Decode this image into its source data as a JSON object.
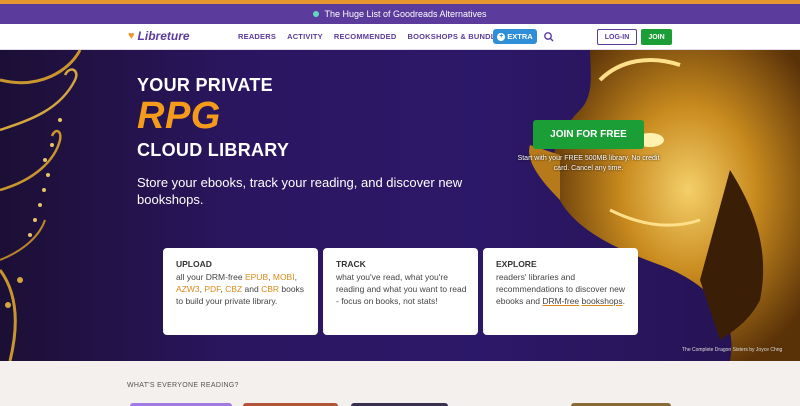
{
  "announcement": {
    "text": "The Huge List of Goodreads Alternatives"
  },
  "nav": {
    "logo": "Libreture",
    "links": [
      "READERS",
      "ACTIVITY",
      "RECOMMENDED",
      "BOOKSHOPS & BUNDLES"
    ],
    "extra": "EXTRA",
    "login": "LOG-IN",
    "join": "JOIN"
  },
  "hero": {
    "line1": "YOUR PRIVATE",
    "line2": "RPG",
    "line3": "CLOUD LIBRARY",
    "subtitle": "Store your ebooks, track your reading, and discover new bookshops.",
    "cta": "JOIN FOR FREE",
    "cta_note": "Start with your FREE 500MB library. No credit card. Cancel any time.",
    "credit": "The Complete Dragon Sisters by Joyce Chng"
  },
  "cards": [
    {
      "title": "UPLOAD",
      "pre": "all your DRM-free ",
      "links": [
        "EPUB",
        "MOBI",
        "AZW3",
        "PDF",
        "CBZ",
        "CBR"
      ],
      "post": " books to build your private library."
    },
    {
      "title": "TRACK",
      "body": "what you've read, what you're reading and what you want to read - focus on books, not stats!"
    },
    {
      "title": "EXPLORE",
      "pre": "readers' libraries and recommendations to discover new ebooks and ",
      "link1": "DRM-free",
      "link2": "bookshops",
      "post": "."
    }
  ],
  "section": {
    "label": "WHAT'S EVERYONE READING?"
  },
  "colors": {
    "brand_purple": "#5b3b9c",
    "accent_orange": "#f59b1c",
    "cta_green": "#1b9e36",
    "extra_blue": "#2e8fd8"
  }
}
